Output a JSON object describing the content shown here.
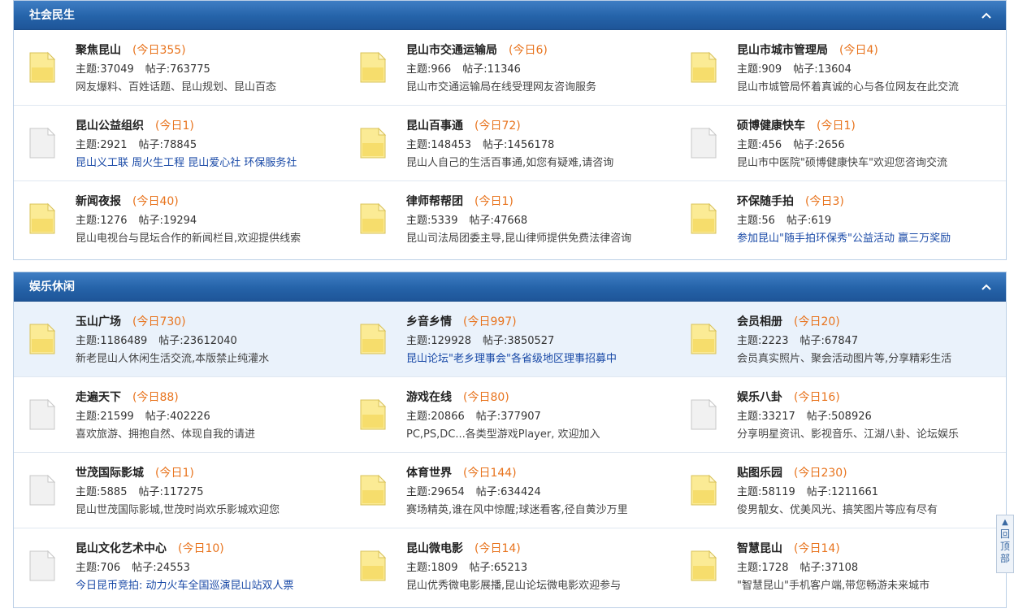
{
  "sections": [
    {
      "title": "社会民生",
      "rows": [
        [
          {
            "name": "聚焦昆山",
            "today": "(今日355)",
            "topics": "主题:37049",
            "posts": "帖子:763775",
            "desc": "网友爆料、百姓话题、昆山规划、昆山百态",
            "link": false,
            "icon": "new"
          },
          {
            "name": "昆山市交通运输局",
            "today": "(今日6)",
            "topics": "主题:966",
            "posts": "帖子:11346",
            "desc": "昆山市交通运输局在线受理网友咨询服务",
            "link": false,
            "icon": "new"
          },
          {
            "name": "昆山市城市管理局",
            "today": "(今日4)",
            "topics": "主题:909",
            "posts": "帖子:13604",
            "desc": "昆山市城管局怀着真诚的心与各位网友在此交流",
            "link": false,
            "icon": "new"
          }
        ],
        [
          {
            "name": "昆山公益组织",
            "today": "(今日1)",
            "topics": "主题:2921",
            "posts": "帖子:78845",
            "desc": "昆山义工联 周火生工程 昆山爱心社 环保服务社",
            "link": true,
            "icon": "old"
          },
          {
            "name": "昆山百事通",
            "today": "(今日72)",
            "topics": "主题:148453",
            "posts": "帖子:1456178",
            "desc": "昆山人自己的生活百事通,如您有疑难,请咨询",
            "link": false,
            "icon": "new"
          },
          {
            "name": "硕博健康快车",
            "today": "(今日1)",
            "topics": "主题:456",
            "posts": "帖子:2656",
            "desc": "昆山市中医院\"硕博健康快车\"欢迎您咨询交流",
            "link": false,
            "icon": "old"
          }
        ],
        [
          {
            "name": "新闻夜报",
            "today": "(今日40)",
            "topics": "主题:1276",
            "posts": "帖子:19294",
            "desc": "昆山电视台与昆坛合作的新闻栏目,欢迎提供线索",
            "link": false,
            "icon": "new"
          },
          {
            "name": "律师帮帮团",
            "today": "(今日1)",
            "topics": "主题:5339",
            "posts": "帖子:47668",
            "desc": "昆山司法局团委主导,昆山律师提供免费法律咨询",
            "link": false,
            "icon": "new"
          },
          {
            "name": "环保随手拍",
            "today": "(今日3)",
            "topics": "主题:56",
            "posts": "帖子:619",
            "desc": "参加昆山\"随手拍环保秀\"公益活动 赢三万奖励",
            "link": true,
            "icon": "new"
          }
        ]
      ]
    },
    {
      "title": "娱乐休闲",
      "rows": [
        [
          {
            "name": "玉山广场",
            "today": "(今日730)",
            "topics": "主题:1186489",
            "posts": "帖子:23612040",
            "desc": "新老昆山人休闲生活交流,本版禁止纯灌水",
            "link": false,
            "icon": "new"
          },
          {
            "name": "乡音乡情",
            "today": "(今日997)",
            "topics": "主题:129928",
            "posts": "帖子:3850527",
            "desc": "昆山论坛\"老乡理事会\"各省级地区理事招募中",
            "link": true,
            "icon": "new"
          },
          {
            "name": "会员相册",
            "today": "(今日20)",
            "topics": "主题:2223",
            "posts": "帖子:67847",
            "desc": "会员真实照片、聚会活动图片等,分享精彩生活",
            "link": false,
            "icon": "new"
          }
        ],
        [
          {
            "name": "走遍天下",
            "today": "(今日88)",
            "topics": "主题:21599",
            "posts": "帖子:402226",
            "desc": "喜欢旅游、拥抱自然、体现自我的请进",
            "link": false,
            "icon": "old"
          },
          {
            "name": "游戏在线",
            "today": "(今日80)",
            "topics": "主题:20866",
            "posts": "帖子:377907",
            "desc": "PC,PS,DC...各类型游戏Player, 欢迎加入",
            "link": false,
            "icon": "new"
          },
          {
            "name": "娱乐八卦",
            "today": "(今日16)",
            "topics": "主题:33217",
            "posts": "帖子:508926",
            "desc": "分享明星资讯、影视音乐、江湖八卦、论坛娱乐",
            "link": false,
            "icon": "old"
          }
        ],
        [
          {
            "name": "世茂国际影城",
            "today": "(今日1)",
            "topics": "主题:5885",
            "posts": "帖子:117275",
            "desc": "昆山世茂国际影城,世茂时尚欢乐影城欢迎您",
            "link": false,
            "icon": "old"
          },
          {
            "name": "体育世界",
            "today": "(今日144)",
            "topics": "主题:29654",
            "posts": "帖子:634424",
            "desc": "赛场精英,谁在风中惊醒;球迷看客,径自黄沙万里",
            "link": false,
            "icon": "new"
          },
          {
            "name": "贴图乐园",
            "today": "(今日230)",
            "topics": "主题:58119",
            "posts": "帖子:1211661",
            "desc": "俊男靓女、优美风光、搞笑图片等应有尽有",
            "link": false,
            "icon": "new"
          }
        ],
        [
          {
            "name": "昆山文化艺术中心",
            "today": "(今日10)",
            "topics": "主题:706",
            "posts": "帖子:24553",
            "desc": "今日昆币竞拍: 动力火车全国巡演昆山站双人票",
            "link": true,
            "icon": "old"
          },
          {
            "name": "昆山微电影",
            "today": "(今日14)",
            "topics": "主题:1809",
            "posts": "帖子:65213",
            "desc": "昆山优秀微电影展播,昆山论坛微电影欢迎参与",
            "link": false,
            "icon": "new"
          },
          {
            "name": "智慧昆山",
            "today": "(今日14)",
            "topics": "主题:1728",
            "posts": "帖子:37108",
            "desc": "\"智慧昆山\"手机客户端,带您畅游未来城市",
            "link": false,
            "icon": "new"
          }
        ]
      ]
    }
  ],
  "backtop": {
    "label": "回顶部"
  },
  "colors": {
    "header": "#2563a9",
    "today": "#e8741e",
    "link": "#1a4aa7",
    "icon_new": "#f7e27a"
  }
}
